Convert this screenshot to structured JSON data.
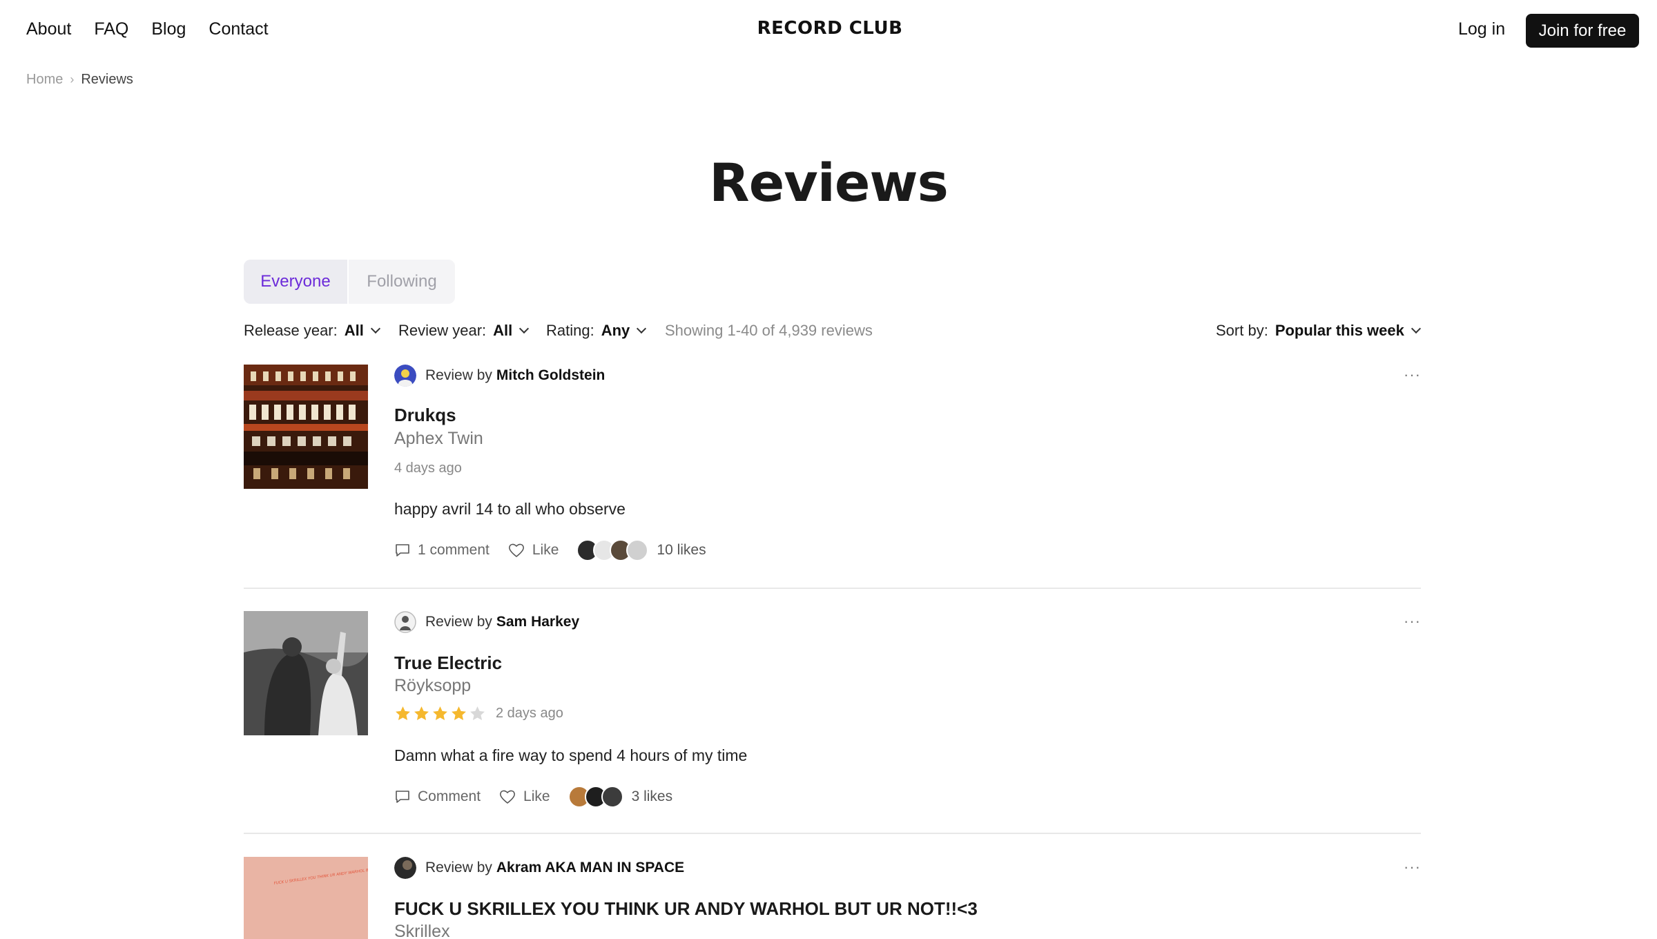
{
  "header": {
    "nav": [
      "About",
      "FAQ",
      "Blog",
      "Contact"
    ],
    "logo": "RECORD CLUB",
    "login": "Log in",
    "join": "Join for free"
  },
  "breadcrumb": {
    "home": "Home",
    "current": "Reviews"
  },
  "page_title": "Reviews",
  "tabs": [
    {
      "label": "Everyone",
      "active": true
    },
    {
      "label": "Following",
      "active": false
    }
  ],
  "filters": {
    "release_year": {
      "label": "Release year:",
      "value": "All"
    },
    "review_year": {
      "label": "Review year:",
      "value": "All"
    },
    "rating": {
      "label": "Rating:",
      "value": "Any"
    },
    "showing": "Showing 1-40 of 4,939 reviews",
    "sort": {
      "label": "Sort by:",
      "value": "Popular this week"
    }
  },
  "reviews": [
    {
      "prefix": "Review by",
      "user": "Mitch Goldstein",
      "album": "Drukqs",
      "artist": "Aphex Twin",
      "rating_stars": null,
      "date": "4 days ago",
      "text": "happy avril 14 to all who observe",
      "comments": "1 comment",
      "like": "Like",
      "likes": "10 likes"
    },
    {
      "prefix": "Review by",
      "user": "Sam Harkey",
      "album": "True Electric",
      "artist": "Röyksopp",
      "rating_stars": 4,
      "date": "2 days ago",
      "text": "Damn what a fire way to spend 4 hours of my time",
      "comments": "Comment",
      "like": "Like",
      "likes": "3 likes"
    },
    {
      "prefix": "Review by",
      "user": "Akram AKA MAN IN SPACE",
      "album": "FUCK U SKRILLEX YOU THINK UR ANDY WARHOL BUT UR NOT!!<3",
      "artist": "Skrillex",
      "cover_text": "FUCK U SKRILLEX YOU THINK UR ANDY WARHOL BUT UR NOT!!<3"
    }
  ],
  "more_icon": "more-horizontal-icon",
  "colors": {
    "accent": "#6c2bd9",
    "star": "#f5b82e",
    "star_empty": "#d8d8d8",
    "button": "#111111"
  }
}
